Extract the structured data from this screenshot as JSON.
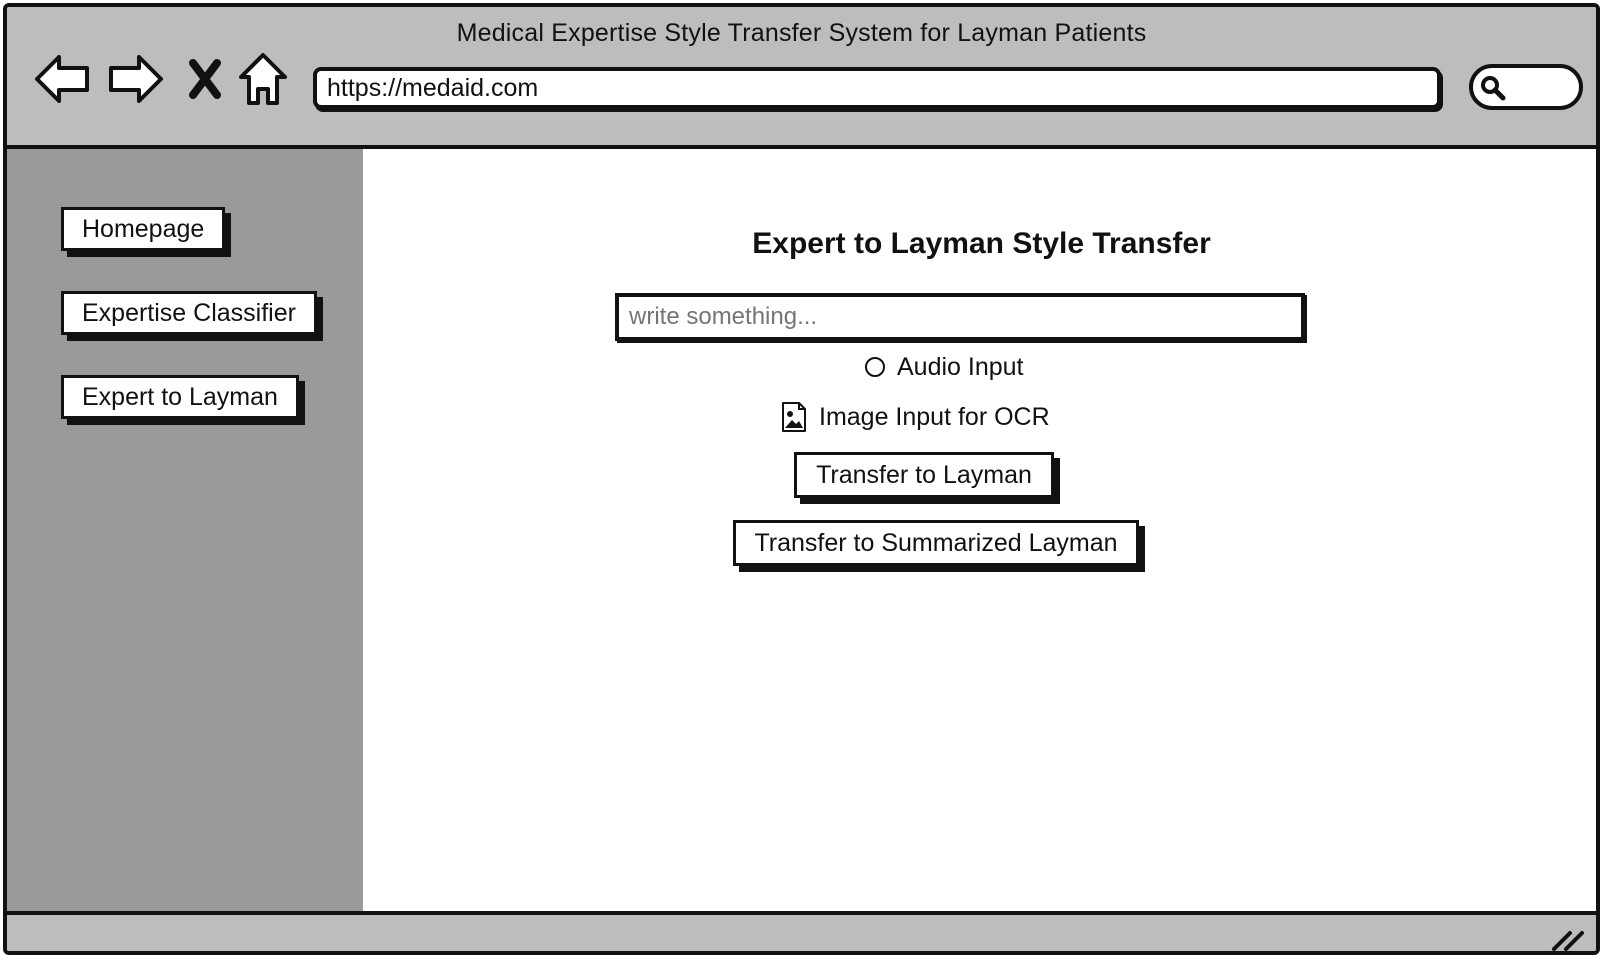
{
  "browser": {
    "title": "Medical Expertise Style Transfer System for Layman Patients",
    "url": "https://medaid.com",
    "nav_icons": [
      "back-arrow-icon",
      "forward-arrow-icon",
      "close-icon",
      "home-icon"
    ],
    "search_icon": "search-icon"
  },
  "sidebar": {
    "items": [
      {
        "label": "Homepage"
      },
      {
        "label": "Expertise Classifier"
      },
      {
        "label": "Expert to Layman"
      }
    ]
  },
  "main": {
    "title": "Expert to Layman Style Transfer",
    "input": {
      "value": "",
      "placeholder": "write something..."
    },
    "audio_option": {
      "label": "Audio Input",
      "selected": false
    },
    "image_option": {
      "label": "Image Input for OCR",
      "icon": "image-file-icon"
    },
    "buttons": {
      "transfer": "Transfer to Layman",
      "transfer_summary": "Transfer to Summarized Layman"
    }
  },
  "colors": {
    "chrome": "#bdbdbd",
    "sidebar": "#9a9a9a",
    "content": "#ffffff",
    "ink": "#111111"
  }
}
